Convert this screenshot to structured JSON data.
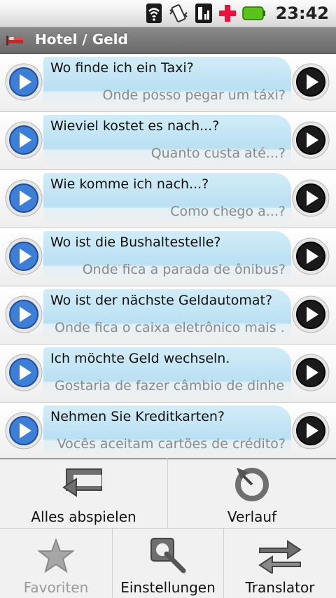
{
  "status_bar": {
    "time": "23:42",
    "icons": [
      "wifi-icon",
      "vibrate-icon",
      "signal-icon",
      "health-cross-icon",
      "battery-icon"
    ]
  },
  "title_bar": {
    "title": "Hotel / Geld",
    "icon": "bed-icon"
  },
  "phrases": [
    {
      "de": "Wo finde ich ein Taxi?",
      "pt": "Onde posso pegar um táxi?"
    },
    {
      "de": "Wieviel kostet es nach...?",
      "pt": "Quanto custa até...?"
    },
    {
      "de": "Wie komme ich nach...?",
      "pt": "Como chego a...?"
    },
    {
      "de": "Wo ist die Bushaltestelle?",
      "pt": "Onde fica a parada de ônibus?"
    },
    {
      "de": "Wo ist der nächste Geldautomat?",
      "pt": "Onde fica o caixa eletrônico mais ..."
    },
    {
      "de": "Ich möchte Geld wechseln.",
      "pt": "Gostaria de fazer câmbio de dinhe..."
    },
    {
      "de": "Nehmen Sie Kreditkarten?",
      "pt": "Vocês aceitam cartões de crédito?"
    }
  ],
  "menu": {
    "play_all": "Alles abspielen",
    "history": "Verlauf",
    "favorites": "Favoriten",
    "settings": "Einstellungen",
    "translator": "Translator"
  },
  "colors": {
    "accent_blue": "#3d7fd6",
    "bubble": "#c4e5f5",
    "title_bar": "#777777",
    "health_cross": "#e8123c",
    "battery": "#5cc21e"
  }
}
